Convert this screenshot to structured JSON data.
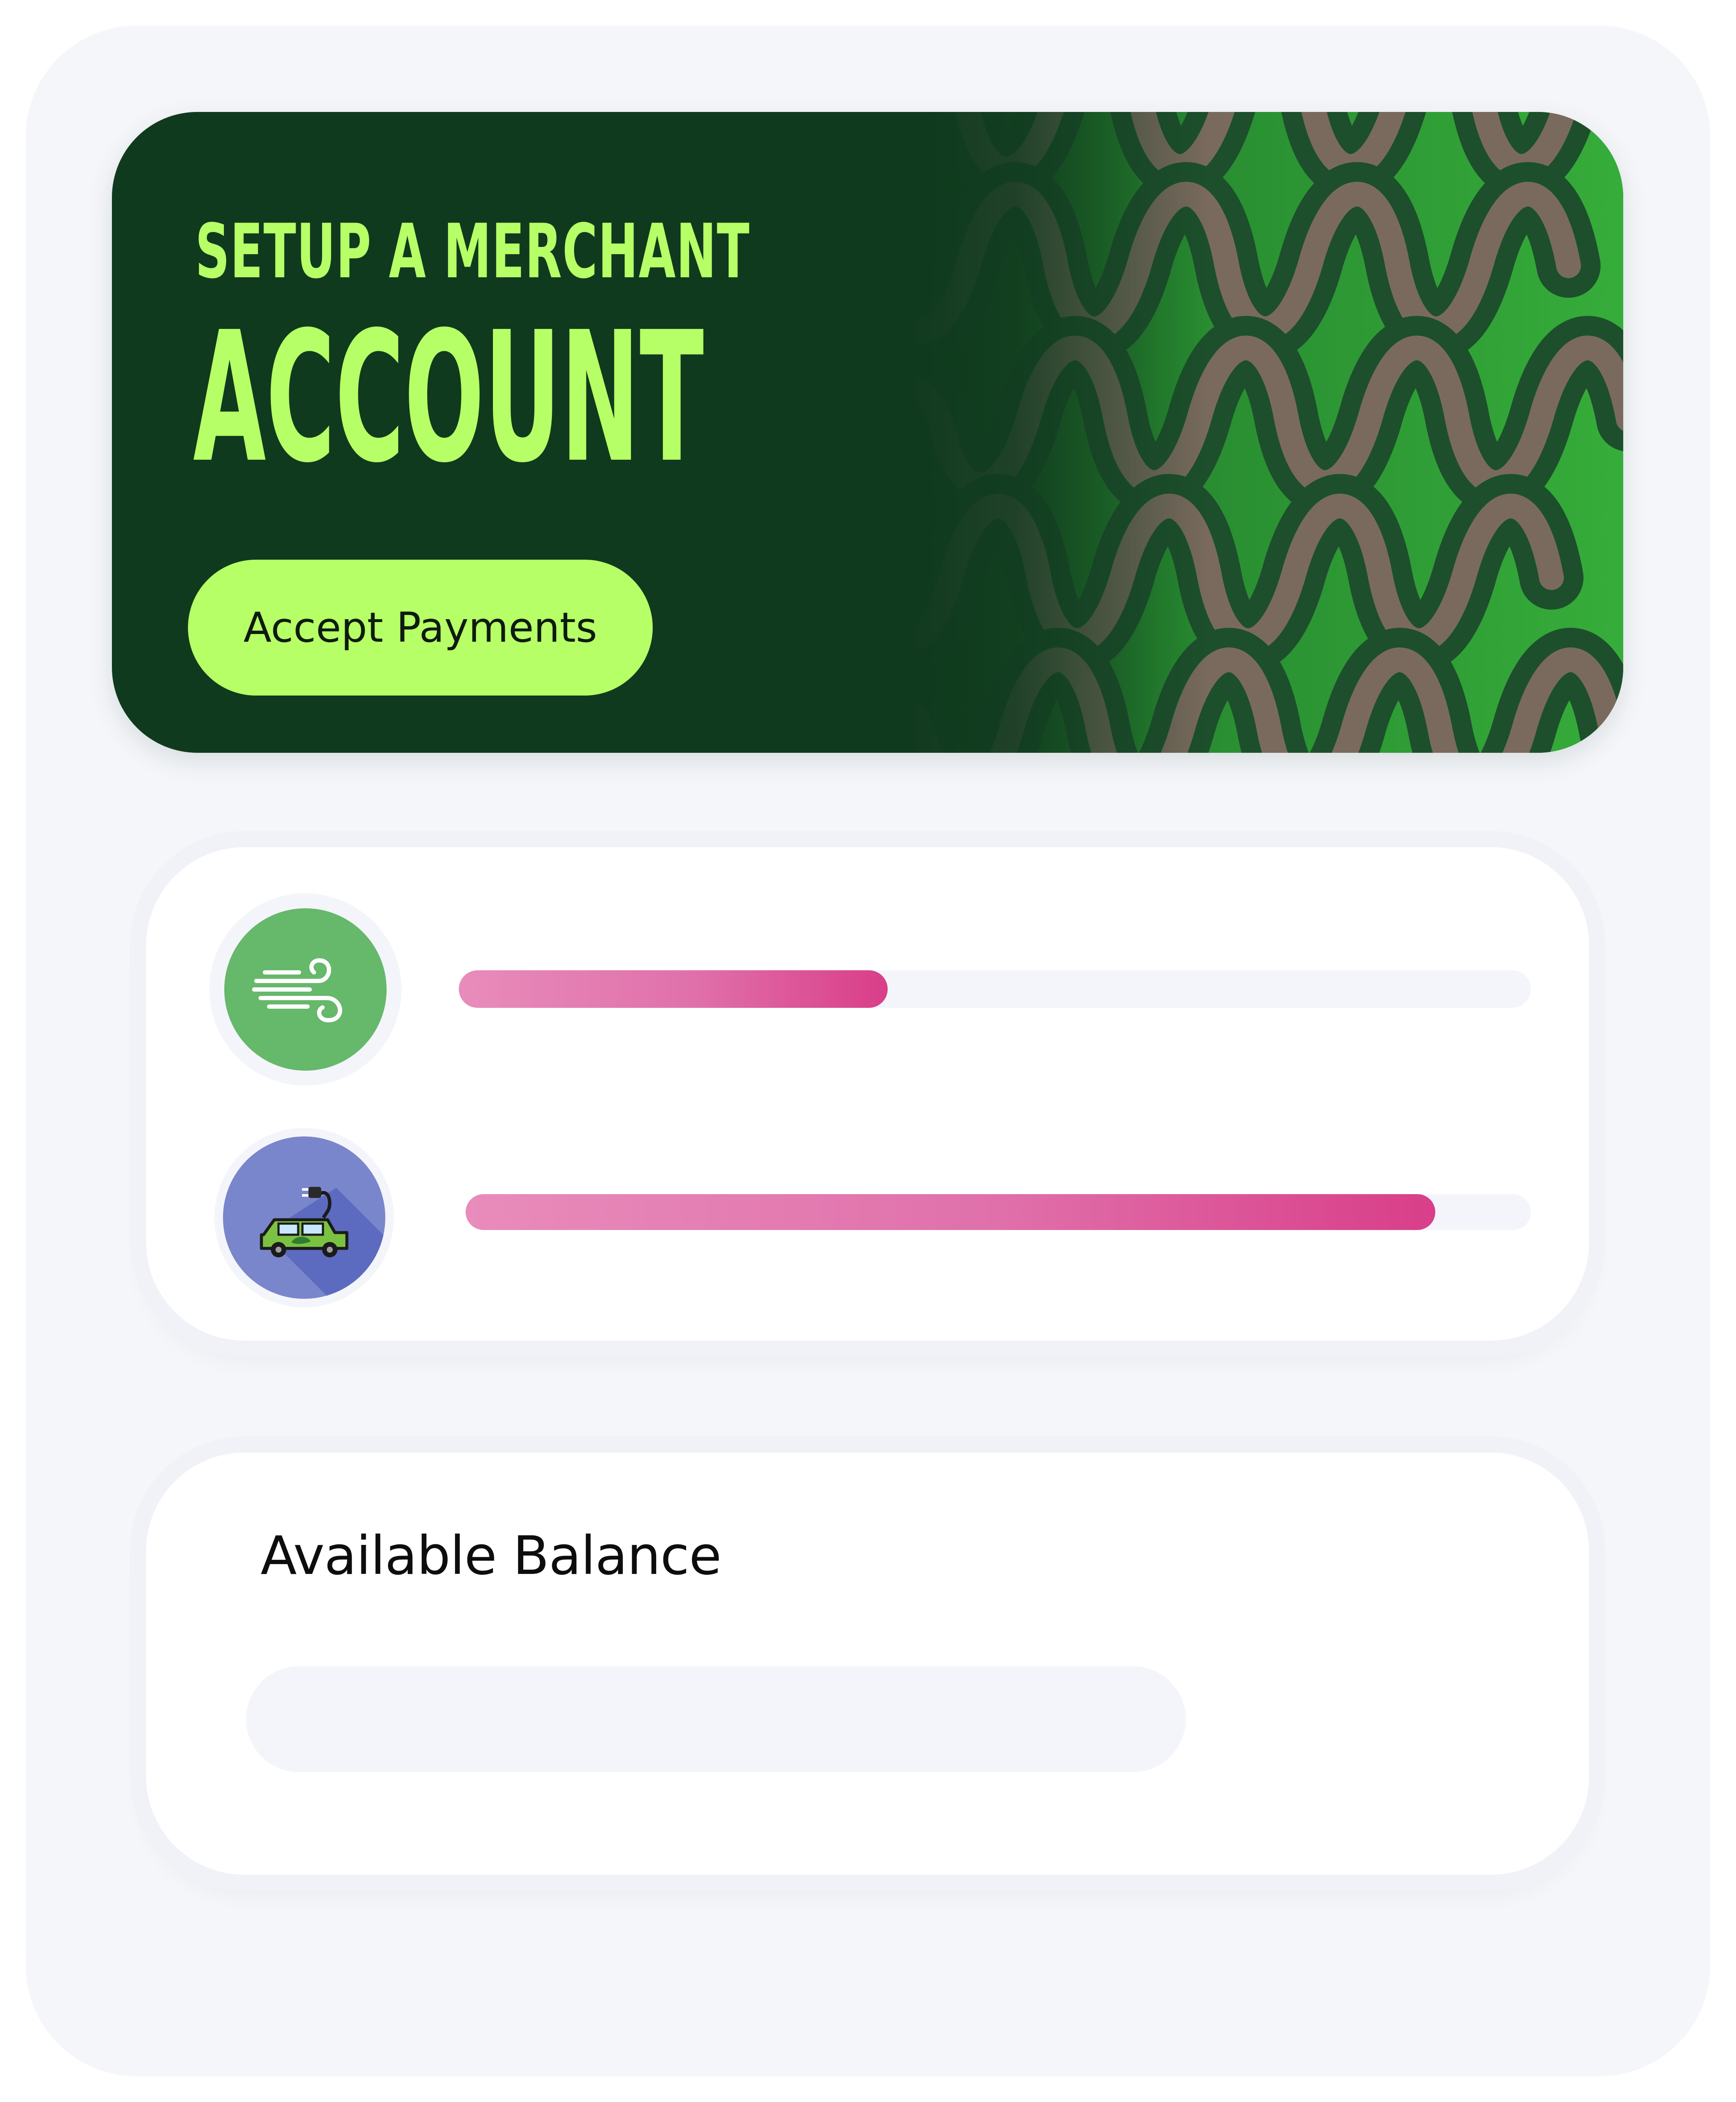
{
  "banner": {
    "title_line1": "SETUP A MERCHANT",
    "title_line2": "ACCOUNT",
    "button_label": "Accept Payments",
    "colors": {
      "background": "#103a1e",
      "accent": "#b7ff66",
      "pattern_green": "#2e9a35",
      "pattern_stroke": "#7a6a5e"
    }
  },
  "progress": {
    "items": [
      {
        "icon": "wind-icon",
        "icon_color": "#66b86a",
        "fraction": 0.4
      },
      {
        "icon": "electric-car-icon",
        "icon_color": "#7986cb",
        "fraction": 0.91
      }
    ],
    "fill_colors": [
      "#e88cbb",
      "#d93e89"
    ]
  },
  "balance": {
    "label": "Available Balance"
  }
}
